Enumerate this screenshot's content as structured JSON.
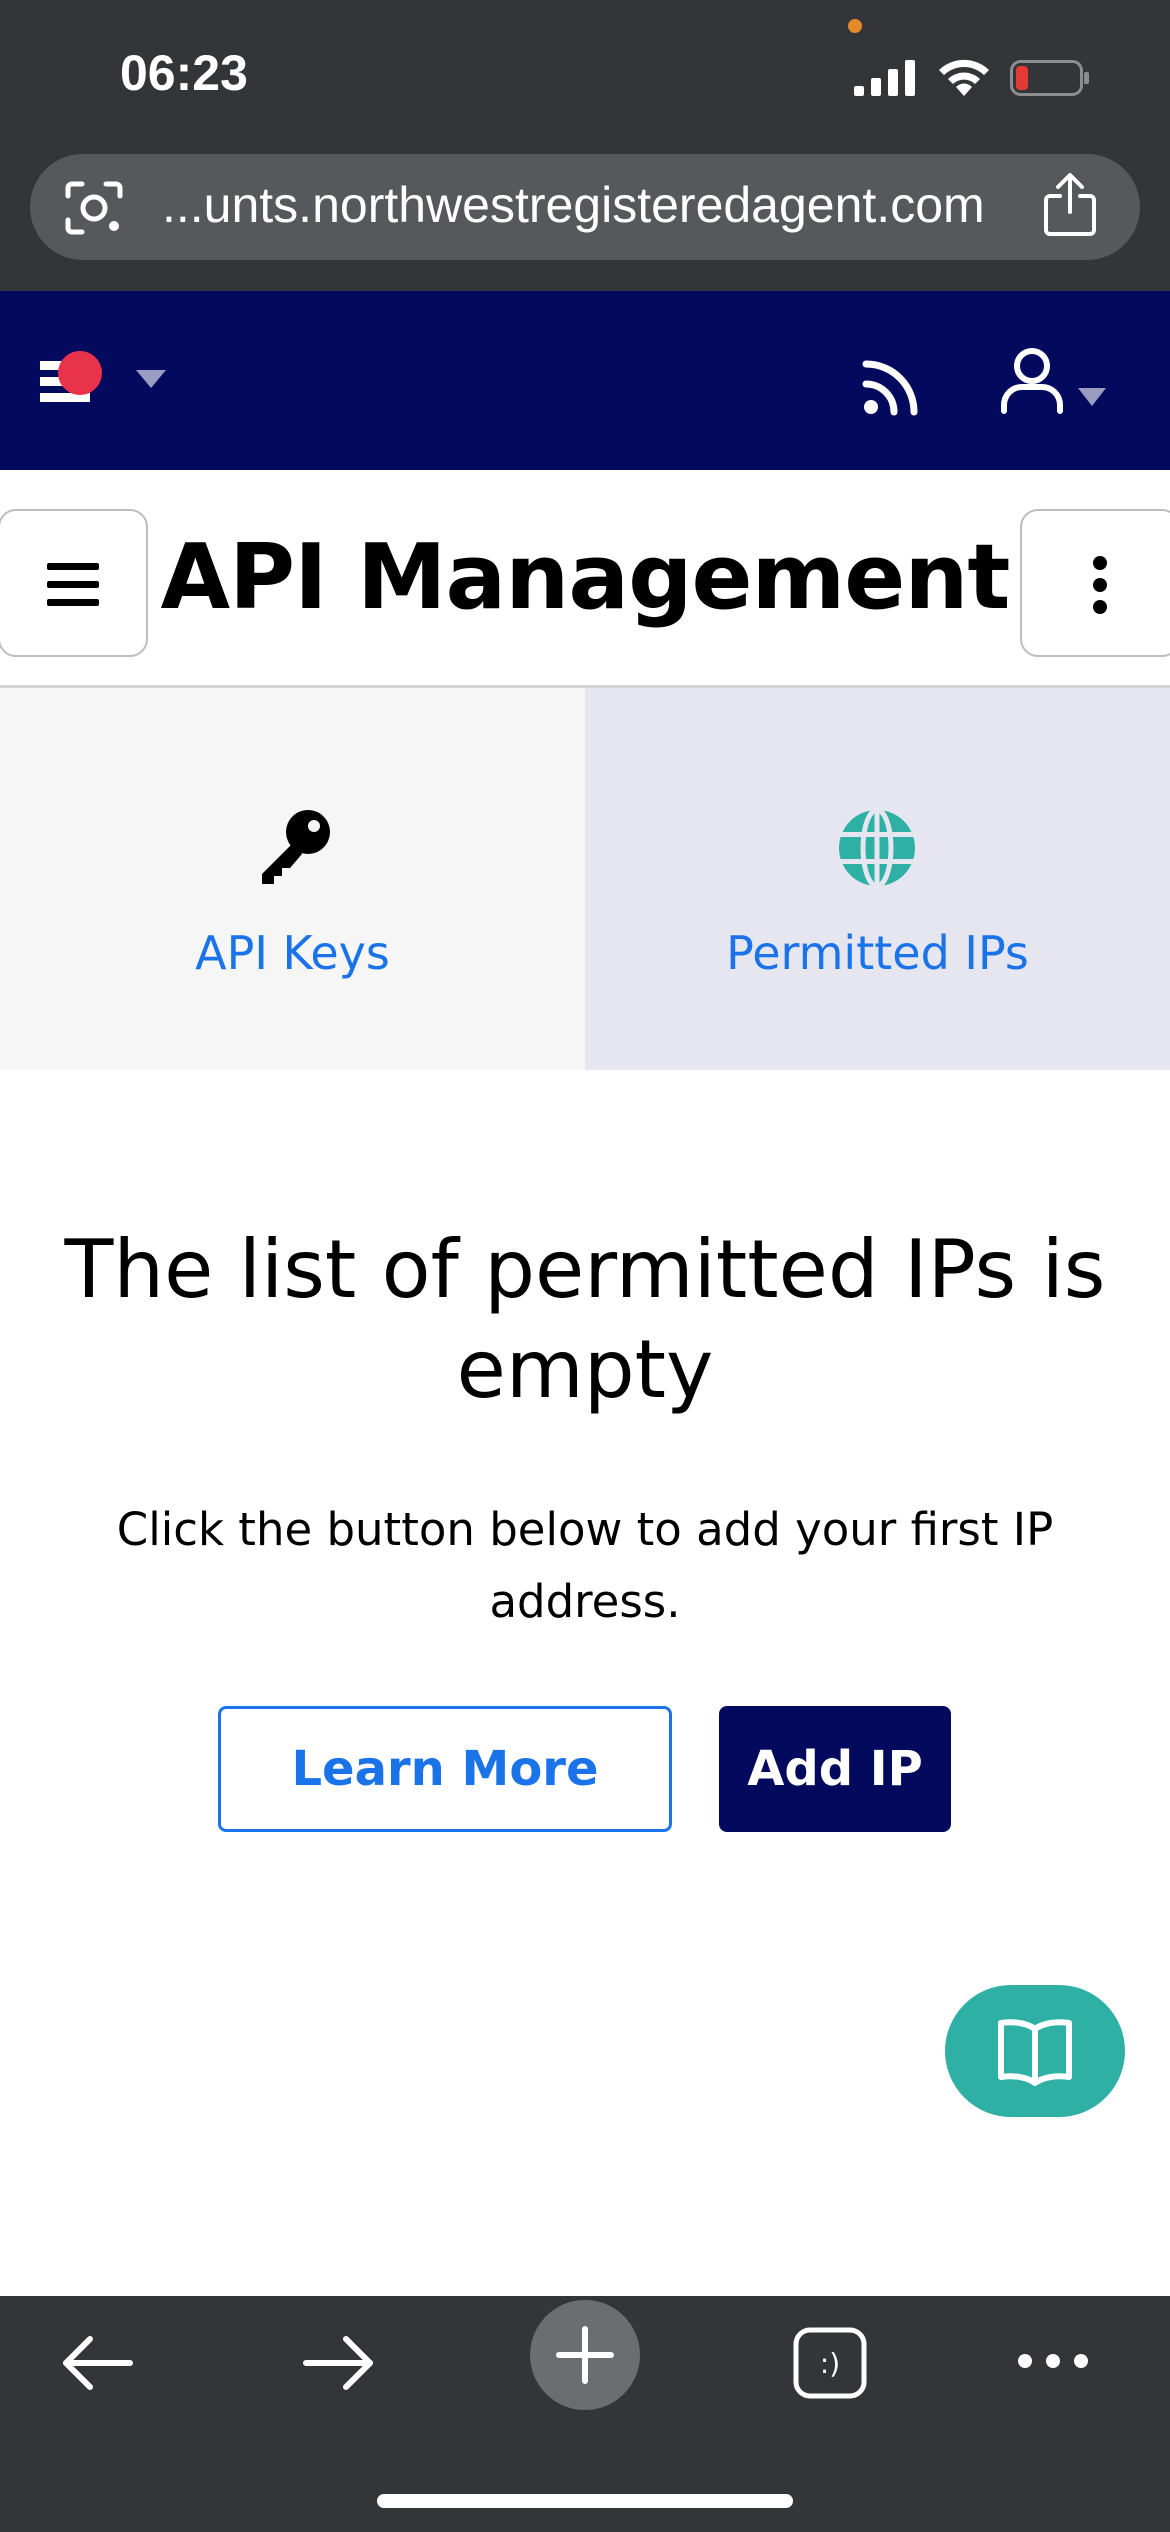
{
  "status_bar": {
    "time": "06:23",
    "battery_state": "low",
    "accent_colors": {
      "battery_low": "#e53935",
      "camera_dot": "#e38a2a"
    }
  },
  "browser": {
    "url": "...unts.northwestregisteredagent.com",
    "icons": [
      "lens-icon",
      "share-icon"
    ]
  },
  "top_nav": {
    "icons": [
      "flag-icon",
      "caret-down-icon",
      "rss-icon",
      "user-icon",
      "caret-down-icon"
    ],
    "background": "#030a5e"
  },
  "header": {
    "title": "API Management",
    "left_button_icon": "hamburger-icon",
    "right_button_icon": "kebab-icon"
  },
  "tabs": [
    {
      "label": "API Keys",
      "icon": "key-icon",
      "selected": false
    },
    {
      "label": "Permitted IPs",
      "icon": "globe-icon",
      "selected": true
    }
  ],
  "empty_state": {
    "title": "The list of permitted IPs is empty",
    "subtitle": "Click the button below to add your first IP address.",
    "learn_more_label": "Learn More",
    "add_ip_label": "Add IP"
  },
  "fab": {
    "icon": "book-icon",
    "color": "#2fb0a4"
  },
  "browser_toolbar": {
    "icons": [
      "back-arrow-icon",
      "forward-arrow-icon",
      "plus-icon",
      "tabs-icon",
      "more-icon"
    ],
    "tabs_badge": ":)"
  }
}
